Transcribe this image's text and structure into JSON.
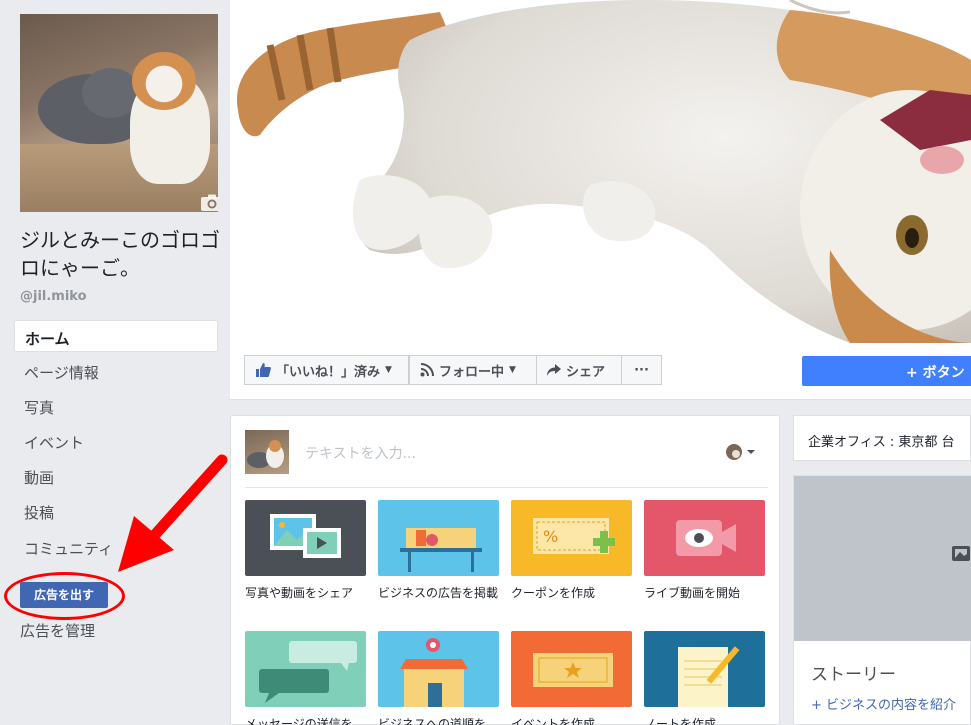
{
  "sidebar": {
    "page_name": "ジルとみーこのゴロゴロにゃーご。",
    "page_handle": "@jil.miko",
    "nav_items": [
      {
        "label": "ホーム"
      },
      {
        "label": "ページ情報"
      },
      {
        "label": "写真"
      },
      {
        "label": "イベント"
      },
      {
        "label": "動画"
      },
      {
        "label": "投稿"
      },
      {
        "label": "コミュニティ"
      }
    ],
    "advertise_label": "広告を出す",
    "manage_ads_label": "広告を管理"
  },
  "action_bar": {
    "like_label": "「いいね！」済み",
    "follow_label": "フォロー中",
    "share_label": "シェア",
    "more_label": "···",
    "primary_label": "+ ボタン"
  },
  "composer": {
    "placeholder": "テキストを入力..."
  },
  "tiles": [
    {
      "label": "写真や動画をシェア",
      "icon": "photo-video-icon",
      "color": "#4b4f56"
    },
    {
      "label": "ビジネスの広告を掲載",
      "icon": "shop-counter-icon",
      "color": "#5ec3e8"
    },
    {
      "label": "クーポンを作成",
      "icon": "coupon-icon",
      "color": "#f7b928"
    },
    {
      "label": "ライブ動画を開始",
      "icon": "live-video-icon",
      "color": "#e4576b"
    },
    {
      "label": "メッセージの送信を",
      "icon": "message-icon",
      "color": "#7fcfb9"
    },
    {
      "label": "ビジネスへの道順を",
      "icon": "store-location-icon",
      "color": "#5ec3e8"
    },
    {
      "label": "イベントを作成",
      "icon": "ticket-icon",
      "color": "#f26b36"
    },
    {
      "label": "ノートを作成",
      "icon": "note-icon",
      "color": "#1e6f99"
    }
  ],
  "right_panel": {
    "office_info": "企業オフィス : 東京都 台",
    "story_title": "ストーリー",
    "story_link": "+ ビジネスの内容を紹介"
  },
  "colors": {
    "brand_blue": "#4267b2",
    "primary_button": "#4080ff",
    "annotation_red": "#ff0000"
  }
}
